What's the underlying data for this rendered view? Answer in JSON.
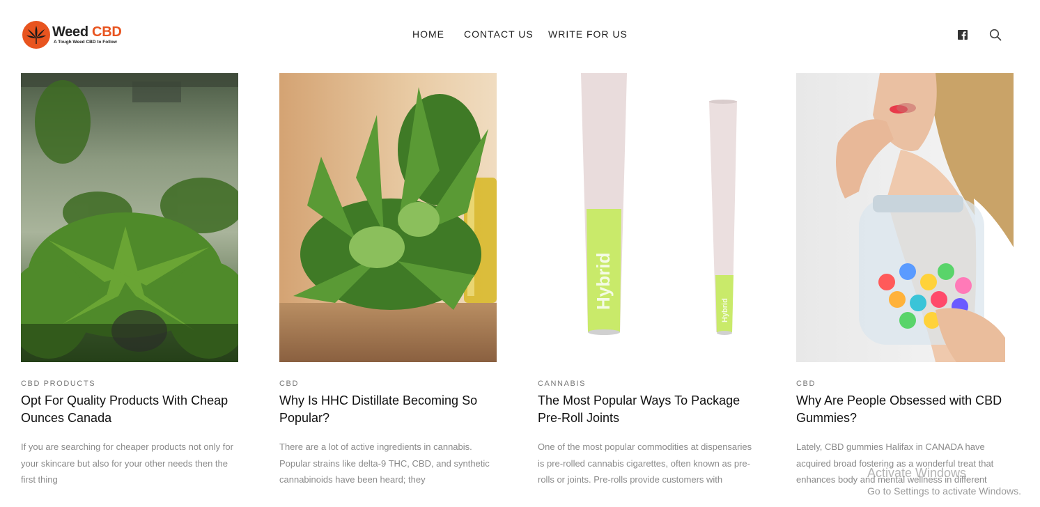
{
  "brand": {
    "name_part1": "Weed",
    "name_part2": "CBD",
    "tagline": "A Tough Weed CBD to Follow",
    "accent_color": "#e8541f"
  },
  "nav": {
    "items": [
      {
        "label": "HOME"
      },
      {
        "label": "CONTACT US"
      },
      {
        "label": "WRITE FOR US"
      }
    ]
  },
  "header_icons": {
    "facebook": "facebook-icon",
    "search": "search-icon"
  },
  "posts": [
    {
      "image": "cannabis-grow-room-photo",
      "category": "CBD PRODUCTS",
      "title": "Opt For Quality Products With Cheap Ounces Canada",
      "excerpt": "If you are searching for cheaper products not only for your skincare but also for your other needs then the first thing"
    },
    {
      "image": "cannabis-plant-oil-photo",
      "category": "CBD",
      "title": "Why Is HHC Distillate Becoming So Popular?",
      "excerpt": "There are a lot of active ingredients in cannabis. Popular strains like delta-9 THC, CBD, and synthetic cannabinoids have been heard; they"
    },
    {
      "image": "pre-roll-cones-photo",
      "category": "CANNABIS",
      "title": "The Most Popular Ways To Package Pre-Roll Joints",
      "excerpt": "One of the most popular commodities at dispensaries is pre-rolled cannabis cigarettes, often known as pre-rolls or joints. Pre-rolls provide customers with",
      "image_text": "Hybrid"
    },
    {
      "image": "woman-eating-gummies-photo",
      "category": "CBD",
      "title": "Why Are People Obsessed with CBD Gummies?",
      "excerpt": "Lately, CBD gummies Halifax in CANADA have acquired broad fostering as a wonderful treat that enhances body and mental wellness in different"
    }
  ],
  "os_watermark": {
    "line1": "Activate Windows",
    "line2": "Go to Settings to activate Windows."
  }
}
